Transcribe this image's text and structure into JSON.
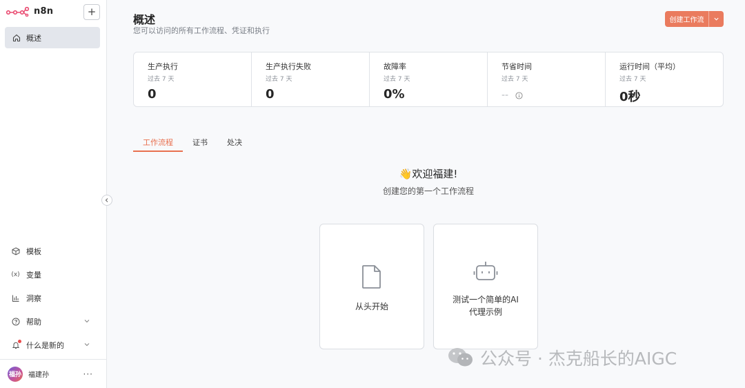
{
  "sidebar": {
    "logo_text": "n8n",
    "add_label": "+",
    "overview_label": "概述",
    "bottom_items": [
      {
        "label": "模板",
        "icon": "box-icon"
      },
      {
        "label": "变量",
        "icon": "variable-icon"
      },
      {
        "label": "洞察",
        "icon": "chart-icon"
      },
      {
        "label": "帮助",
        "icon": "help-icon"
      },
      {
        "label": "什么是新的",
        "icon": "bell-icon"
      }
    ],
    "user_name": "福建孙",
    "user_initials": "福孙",
    "more_label": "···"
  },
  "header": {
    "title": "概述",
    "subtitle": "您可以访问的所有工作流程、凭证和执行",
    "create_label": "创建工作流"
  },
  "stats": [
    {
      "label": "生产执行",
      "sub": "过去 7 天",
      "value": "0"
    },
    {
      "label": "生产执行失败",
      "sub": "过去 7 天",
      "value": "0"
    },
    {
      "label": "故障率",
      "sub": "过去 7 天",
      "value": "0%"
    },
    {
      "label": "节省时间",
      "sub": "过去 7 天",
      "value": "--"
    },
    {
      "label": "运行时间（平均）",
      "sub": "过去 7 天",
      "value": "0秒"
    }
  ],
  "tabs": [
    "工作流程",
    "证书",
    "处决"
  ],
  "welcome": {
    "title": "👋欢迎福建!",
    "subtitle": "创建您的第一个工作流程"
  },
  "cards": [
    {
      "label": "从头开始"
    },
    {
      "label_line1": "测试一个简单的AI",
      "label_line2": "代理示例"
    }
  ],
  "watermark": {
    "text": "公众号 · 杰克船长的AIGC"
  },
  "colors": {
    "accent": "#ea7b5e",
    "tab_active": "#e8704f"
  }
}
